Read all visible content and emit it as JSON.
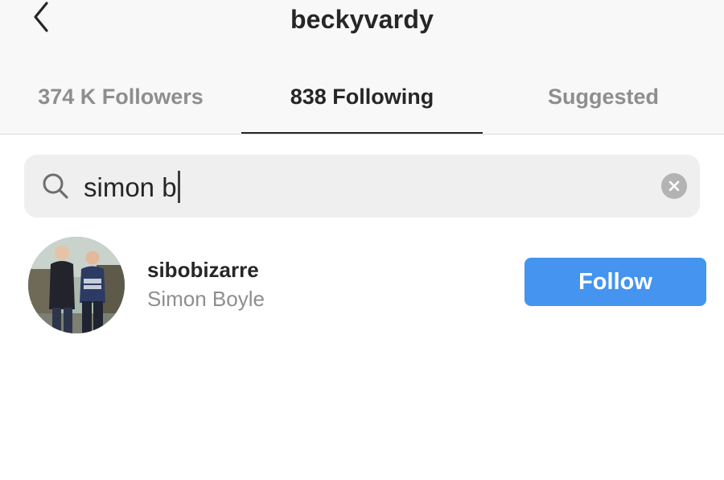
{
  "header": {
    "title": "beckyvardy",
    "back_icon": "chevron-left-icon"
  },
  "tabs": [
    {
      "label": "374 K Followers",
      "active": false
    },
    {
      "label": "838 Following",
      "active": true
    },
    {
      "label": "Suggested",
      "active": false
    }
  ],
  "search": {
    "value": "simon b",
    "search_icon": "search-icon",
    "clear_icon": "clear-icon"
  },
  "results": [
    {
      "username": "sibobizarre",
      "full_name": "Simon Boyle",
      "action_label": "Follow"
    }
  ],
  "colors": {
    "accent": "#4494f0",
    "text_primary": "#262626",
    "text_secondary": "#8e8e8e",
    "header_bg": "#f8f8f8",
    "search_bg": "#efefef"
  }
}
